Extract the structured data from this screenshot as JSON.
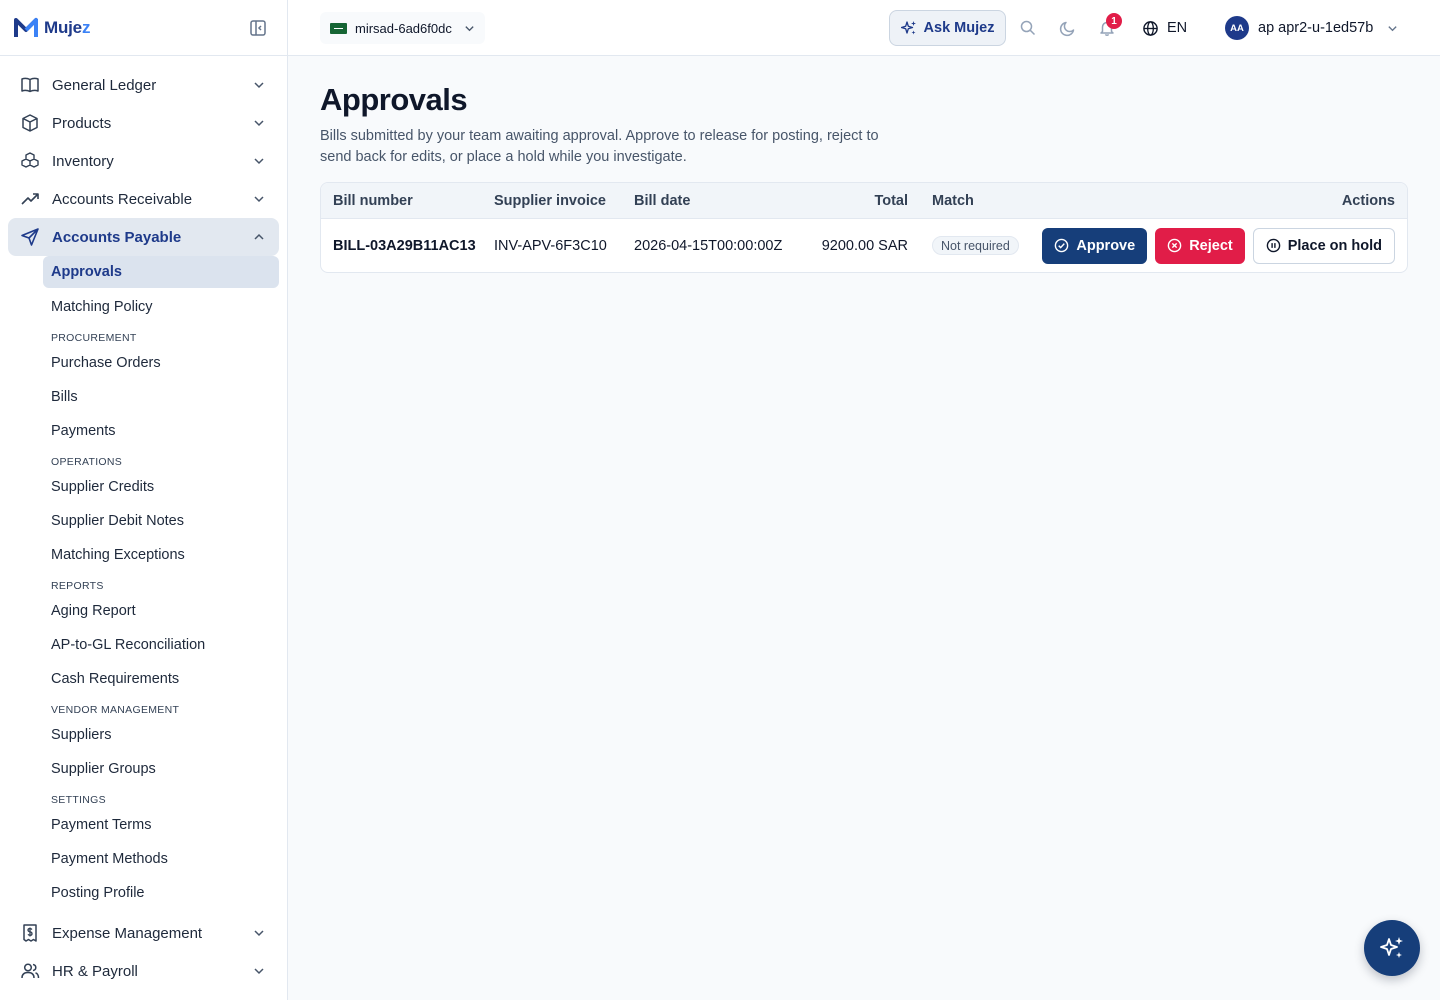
{
  "brand": {
    "name_prefix": "Muje",
    "name_suffix": "z",
    "accent": "#1e3a8a"
  },
  "topbar": {
    "tenant": "mirsad-6ad6f0dc",
    "ask_label": "Ask Mujez",
    "notifications_count": "1",
    "language": "EN",
    "user_initials": "AA",
    "user_name": "ap apr2-u-1ed57b"
  },
  "sidebar": {
    "groups_top": [
      {
        "label": "General Ledger",
        "icon": "book-icon"
      },
      {
        "label": "Products",
        "icon": "box-icon"
      },
      {
        "label": "Inventory",
        "icon": "boxes-icon"
      },
      {
        "label": "Accounts Receivable",
        "icon": "trending-up-icon"
      }
    ],
    "active_group": {
      "label": "Accounts Payable",
      "icon": "send-icon"
    },
    "sub": {
      "approvals": "Approvals",
      "matching_policy": "Matching Policy",
      "procurement_heading": "PROCUREMENT",
      "purchase_orders": "Purchase Orders",
      "bills": "Bills",
      "payments": "Payments",
      "operations_heading": "OPERATIONS",
      "supplier_credits": "Supplier Credits",
      "supplier_debit_notes": "Supplier Debit Notes",
      "matching_exceptions": "Matching Exceptions",
      "reports_heading": "REPORTS",
      "aging_report": "Aging Report",
      "ap_gl_reconciliation": "AP-to-GL Reconciliation",
      "cash_requirements": "Cash Requirements",
      "vendor_heading": "VENDOR MANAGEMENT",
      "suppliers": "Suppliers",
      "supplier_groups": "Supplier Groups",
      "settings_heading": "SETTINGS",
      "payment_terms": "Payment Terms",
      "payment_methods": "Payment Methods",
      "posting_profile": "Posting Profile"
    },
    "groups_bottom": [
      {
        "label": "Expense Management",
        "icon": "receipt-icon"
      },
      {
        "label": "HR & Payroll",
        "icon": "users-icon"
      }
    ]
  },
  "main": {
    "title": "Approvals",
    "description": "Bills submitted by your team awaiting approval. Approve to release for posting, reject to send back for edits, or place a hold while you investigate.",
    "table": {
      "headers": {
        "bill_number": "Bill number",
        "supplier_invoice": "Supplier invoice",
        "bill_date": "Bill date",
        "total": "Total",
        "match": "Match",
        "actions": "Actions"
      },
      "rows": [
        {
          "bill_number": "BILL-03A29B11AC13",
          "supplier_invoice": "INV-APV-6F3C10",
          "bill_date": "2026-04-15T00:00:00Z",
          "total": "9200.00 SAR",
          "match": "Not required"
        }
      ],
      "actions": {
        "approve": "Approve",
        "reject": "Reject",
        "hold": "Place on hold"
      }
    }
  },
  "colors": {
    "primary": "#163e7a",
    "danger": "#e11d48",
    "badge": "#e11d48"
  }
}
